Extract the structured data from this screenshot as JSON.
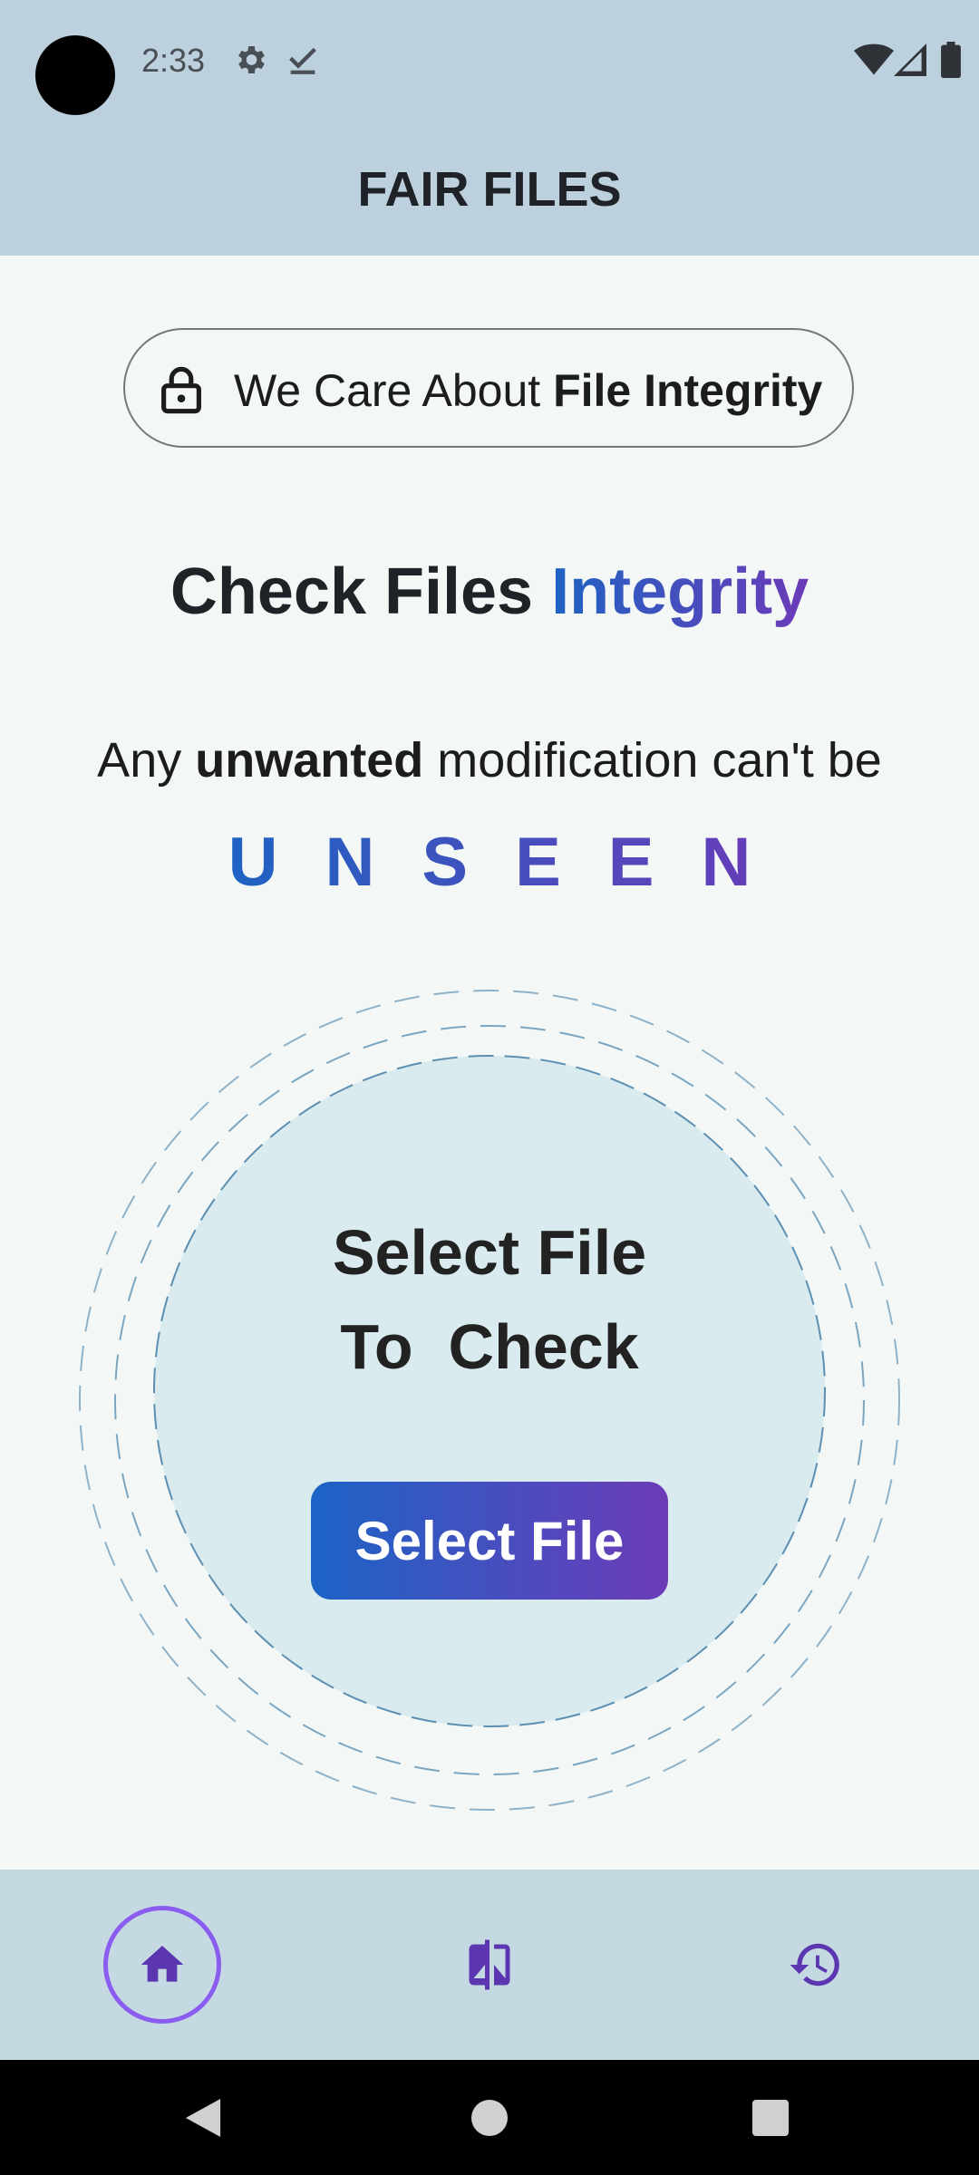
{
  "status_bar": {
    "time": "2:33"
  },
  "app": {
    "title": "FAIR FILES"
  },
  "badge": {
    "text_regular": "We Care About ",
    "text_bold": "File Integrity"
  },
  "headline": {
    "plain": "Check Files ",
    "accent": "Integrity"
  },
  "subtitle": {
    "pre": "Any ",
    "bold": "unwanted",
    "post": " modification can't be"
  },
  "emphasis": "UNSEEN",
  "select_area": {
    "line1": "Select File",
    "line2": "To  Check",
    "button_label": "Select File"
  },
  "bottom_nav": {
    "items": [
      "home-icon",
      "compare-icon",
      "history-icon"
    ],
    "active": "home"
  },
  "colors": {
    "accent_start": "#1e63c3",
    "accent_end": "#6c3ab8",
    "bar_bg": "#bdd0dd",
    "nav_bg": "#c4d9e1"
  }
}
